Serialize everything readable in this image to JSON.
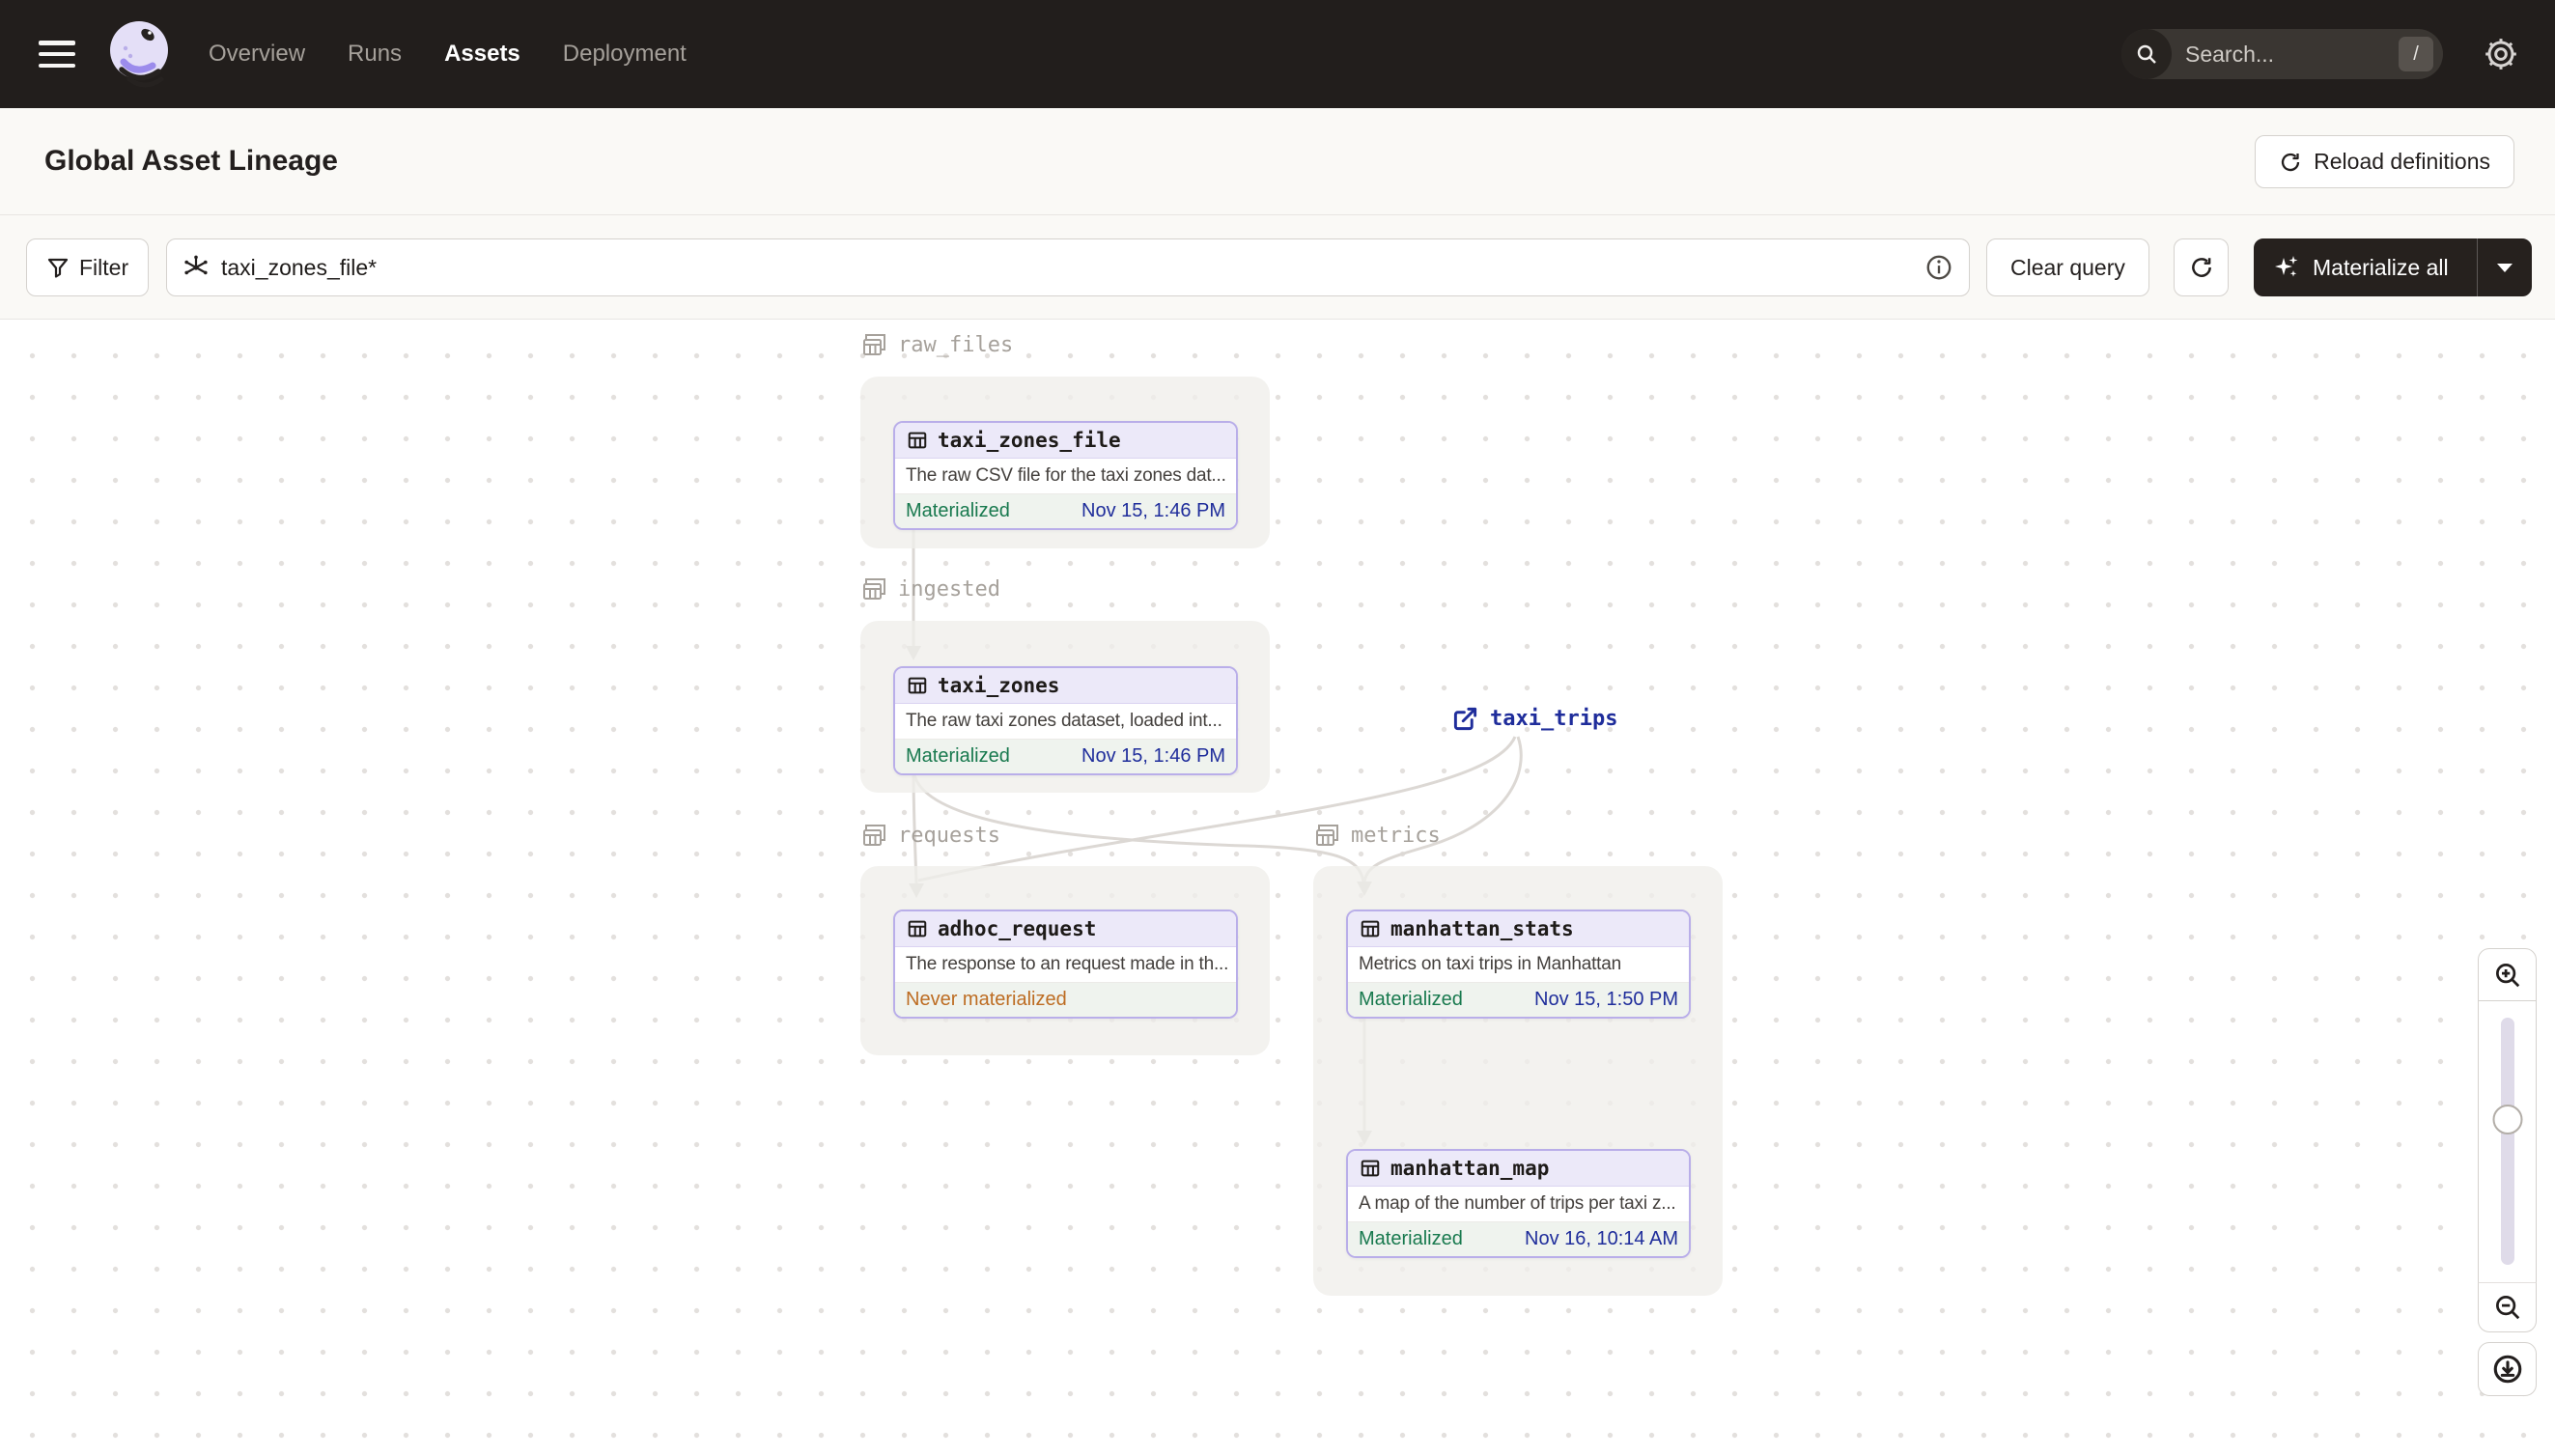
{
  "nav": {
    "items": [
      {
        "label": "Overview",
        "active": false
      },
      {
        "label": "Runs",
        "active": false
      },
      {
        "label": "Assets",
        "active": true
      },
      {
        "label": "Deployment",
        "active": false
      }
    ],
    "search_placeholder": "Search...",
    "search_shortcut": "/"
  },
  "header": {
    "title": "Global Asset Lineage",
    "reload_button": "Reload definitions"
  },
  "toolbar": {
    "filter_label": "Filter",
    "query_value": "taxi_zones_file*",
    "clear_query_label": "Clear query",
    "materialize_label": "Materialize all"
  },
  "graph": {
    "groups": [
      {
        "name": "raw_files"
      },
      {
        "name": "ingested"
      },
      {
        "name": "requests"
      },
      {
        "name": "metrics"
      }
    ],
    "nodes": [
      {
        "id": "taxi_zones_file",
        "group": "raw_files",
        "description": "The raw CSV file for the taxi zones dat...",
        "status": "Materialized",
        "status_kind": "materialized",
        "timestamp": "Nov 15, 1:46 PM"
      },
      {
        "id": "taxi_zones",
        "group": "ingested",
        "description": "The raw taxi zones dataset, loaded int...",
        "status": "Materialized",
        "status_kind": "materialized",
        "timestamp": "Nov 15, 1:46 PM"
      },
      {
        "id": "adhoc_request",
        "group": "requests",
        "description": "The response to an request made in th...",
        "status": "Never materialized",
        "status_kind": "never_materialized",
        "timestamp": ""
      },
      {
        "id": "manhattan_stats",
        "group": "metrics",
        "description": "Metrics on taxi trips in Manhattan",
        "status": "Materialized",
        "status_kind": "materialized",
        "timestamp": "Nov 15, 1:50 PM"
      },
      {
        "id": "manhattan_map",
        "group": "metrics",
        "description": "A map of the number of trips per taxi z...",
        "status": "Materialized",
        "status_kind": "materialized",
        "timestamp": "Nov 16, 10:14 AM"
      }
    ],
    "external_assets": [
      {
        "id": "taxi_trips"
      }
    ],
    "edges": [
      "taxi_zones_file -> taxi_zones",
      "taxi_zones -> adhoc_request",
      "taxi_zones -> manhattan_stats",
      "taxi_trips -> adhoc_request",
      "taxi_trips -> manhattan_stats",
      "manhattan_stats -> manhattan_map"
    ]
  },
  "colors": {
    "nav_bg": "#221E1C",
    "node_border": "#B9AEE9",
    "node_header_bg": "#ECE9F9",
    "materialized_green": "#18794E",
    "timestamp_navy": "#1F2D9B",
    "never_materialized_orange": "#BD6C22",
    "group_label_gray": "#A6A19B",
    "edge_gray": "#DCD8D4"
  }
}
